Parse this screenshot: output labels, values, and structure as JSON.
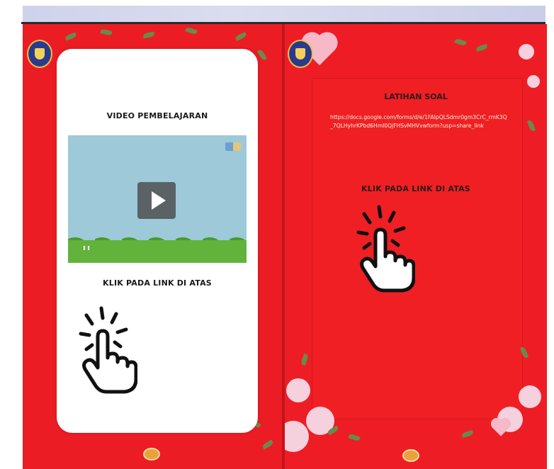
{
  "left_page": {
    "video_title": "VIDEO PEMBELAJARAN",
    "click_instruction": "KLIK PADA LINK DI ATAS",
    "video": {
      "play_icon": "play-icon"
    }
  },
  "right_page": {
    "title": "LATIHAN SOAL",
    "form_link": "https://docs.google.com/forms/d/e/1FAIpQLSdmr0gm3CrC_rmK3Q_7QLHyhrKPbd6HmI0QjFHSvMHVvwform?usp=share_link",
    "click_instruction": "KLIK PADA LINK DI ATAS"
  },
  "icons": {
    "hand": "tap-hand-icon",
    "logo": "school-emblem-icon",
    "nav": "page-nav-dot-icon"
  },
  "colors": {
    "page_red": "#ec1c24",
    "card_white": "#ffffff",
    "label_text": "#1a1a1a",
    "link_text": "#fff4d8"
  }
}
